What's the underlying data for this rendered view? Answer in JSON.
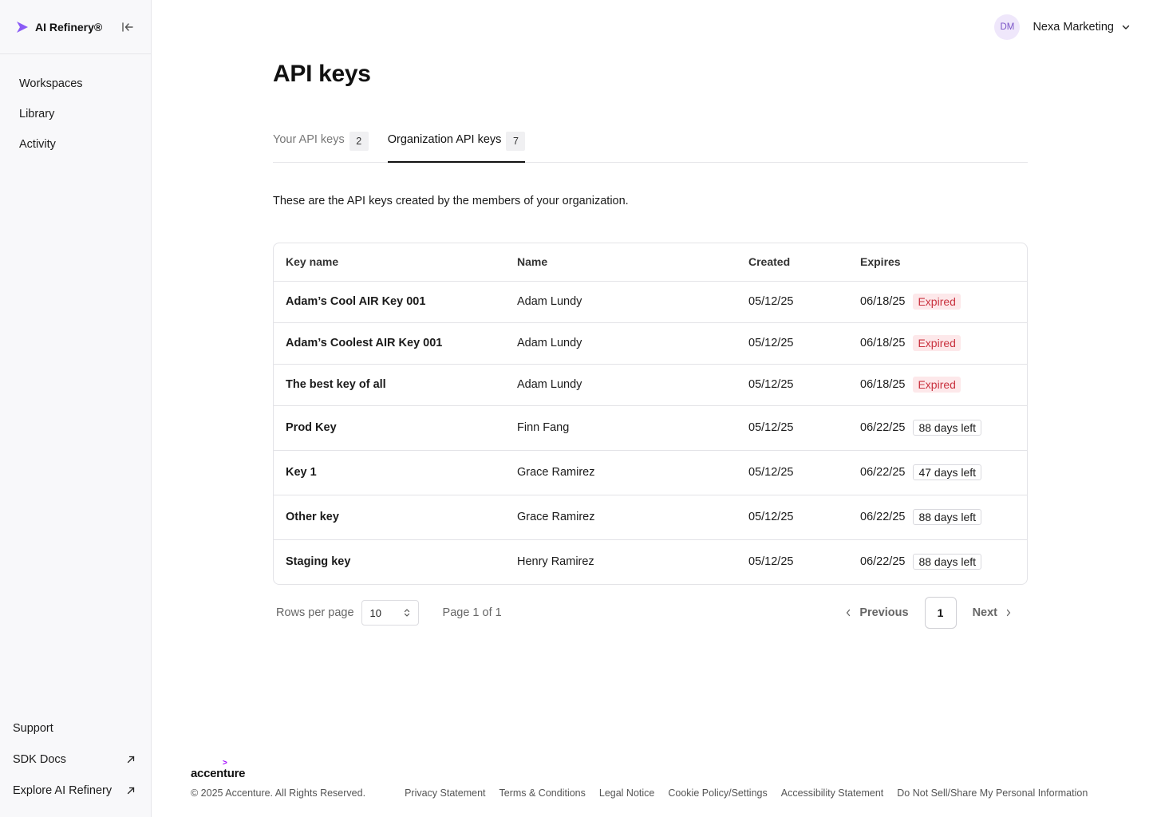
{
  "brand": {
    "name": "AI Refinery®",
    "accent": "#8b5cf6"
  },
  "sidebar": {
    "items": [
      {
        "label": "Workspaces"
      },
      {
        "label": "Library"
      },
      {
        "label": "Activity"
      }
    ],
    "bottom": [
      {
        "label": "Support"
      },
      {
        "label": "SDK Docs"
      },
      {
        "label": "Explore AI Refinery"
      }
    ]
  },
  "header": {
    "avatar_initials": "DM",
    "org_name": "Nexa Marketing"
  },
  "main": {
    "title": "API keys",
    "tabs": [
      {
        "label": "Your API keys",
        "count": "2"
      },
      {
        "label": "Organization API keys",
        "count": "7"
      }
    ],
    "description": "These are the API keys created by the members of your organization.",
    "table": {
      "columns": [
        "Key name",
        "Name",
        "Created",
        "Expires"
      ],
      "rows": [
        {
          "key_name": "Adam’s Cool AIR Key 001",
          "name": "Adam Lundy",
          "created": "05/12/25",
          "expires": "06/18/25",
          "status": "Expired"
        },
        {
          "key_name": "Adam’s Coolest AIR Key 001",
          "name": "Adam Lundy",
          "created": "05/12/25",
          "expires": "06/18/25",
          "status": "Expired"
        },
        {
          "key_name": "The best key of all",
          "name": "Adam Lundy",
          "created": "05/12/25",
          "expires": "06/18/25",
          "status": "Expired"
        },
        {
          "key_name": "Prod Key",
          "name": "Finn Fang",
          "created": "05/12/25",
          "expires": "06/22/25",
          "status": "88 days left"
        },
        {
          "key_name": "Key 1",
          "name": "Grace Ramirez",
          "created": "05/12/25",
          "expires": "06/22/25",
          "status": "47 days left"
        },
        {
          "key_name": "Other key",
          "name": "Grace Ramirez",
          "created": "05/12/25",
          "expires": "06/22/25",
          "status": "88 days left"
        },
        {
          "key_name": "Staging key",
          "name": "Henry Ramirez",
          "created": "05/12/25",
          "expires": "06/22/25",
          "status": "88 days left"
        }
      ]
    },
    "pagination": {
      "rows_per_page_label": "Rows per page",
      "rows_per_page_value": "10",
      "page_info": "Page 1 of 1",
      "previous_label": "Previous",
      "current_page": "1",
      "next_label": "Next"
    }
  },
  "footer": {
    "logo": "accenture",
    "copyright": "© 2025 Accenture. All Rights Reserved.",
    "links": [
      "Privacy Statement",
      "Terms & Conditions",
      "Legal Notice",
      "Cookie Policy/Settings",
      "Accessibility Statement",
      "Do Not Sell/Share My Personal Information"
    ]
  }
}
